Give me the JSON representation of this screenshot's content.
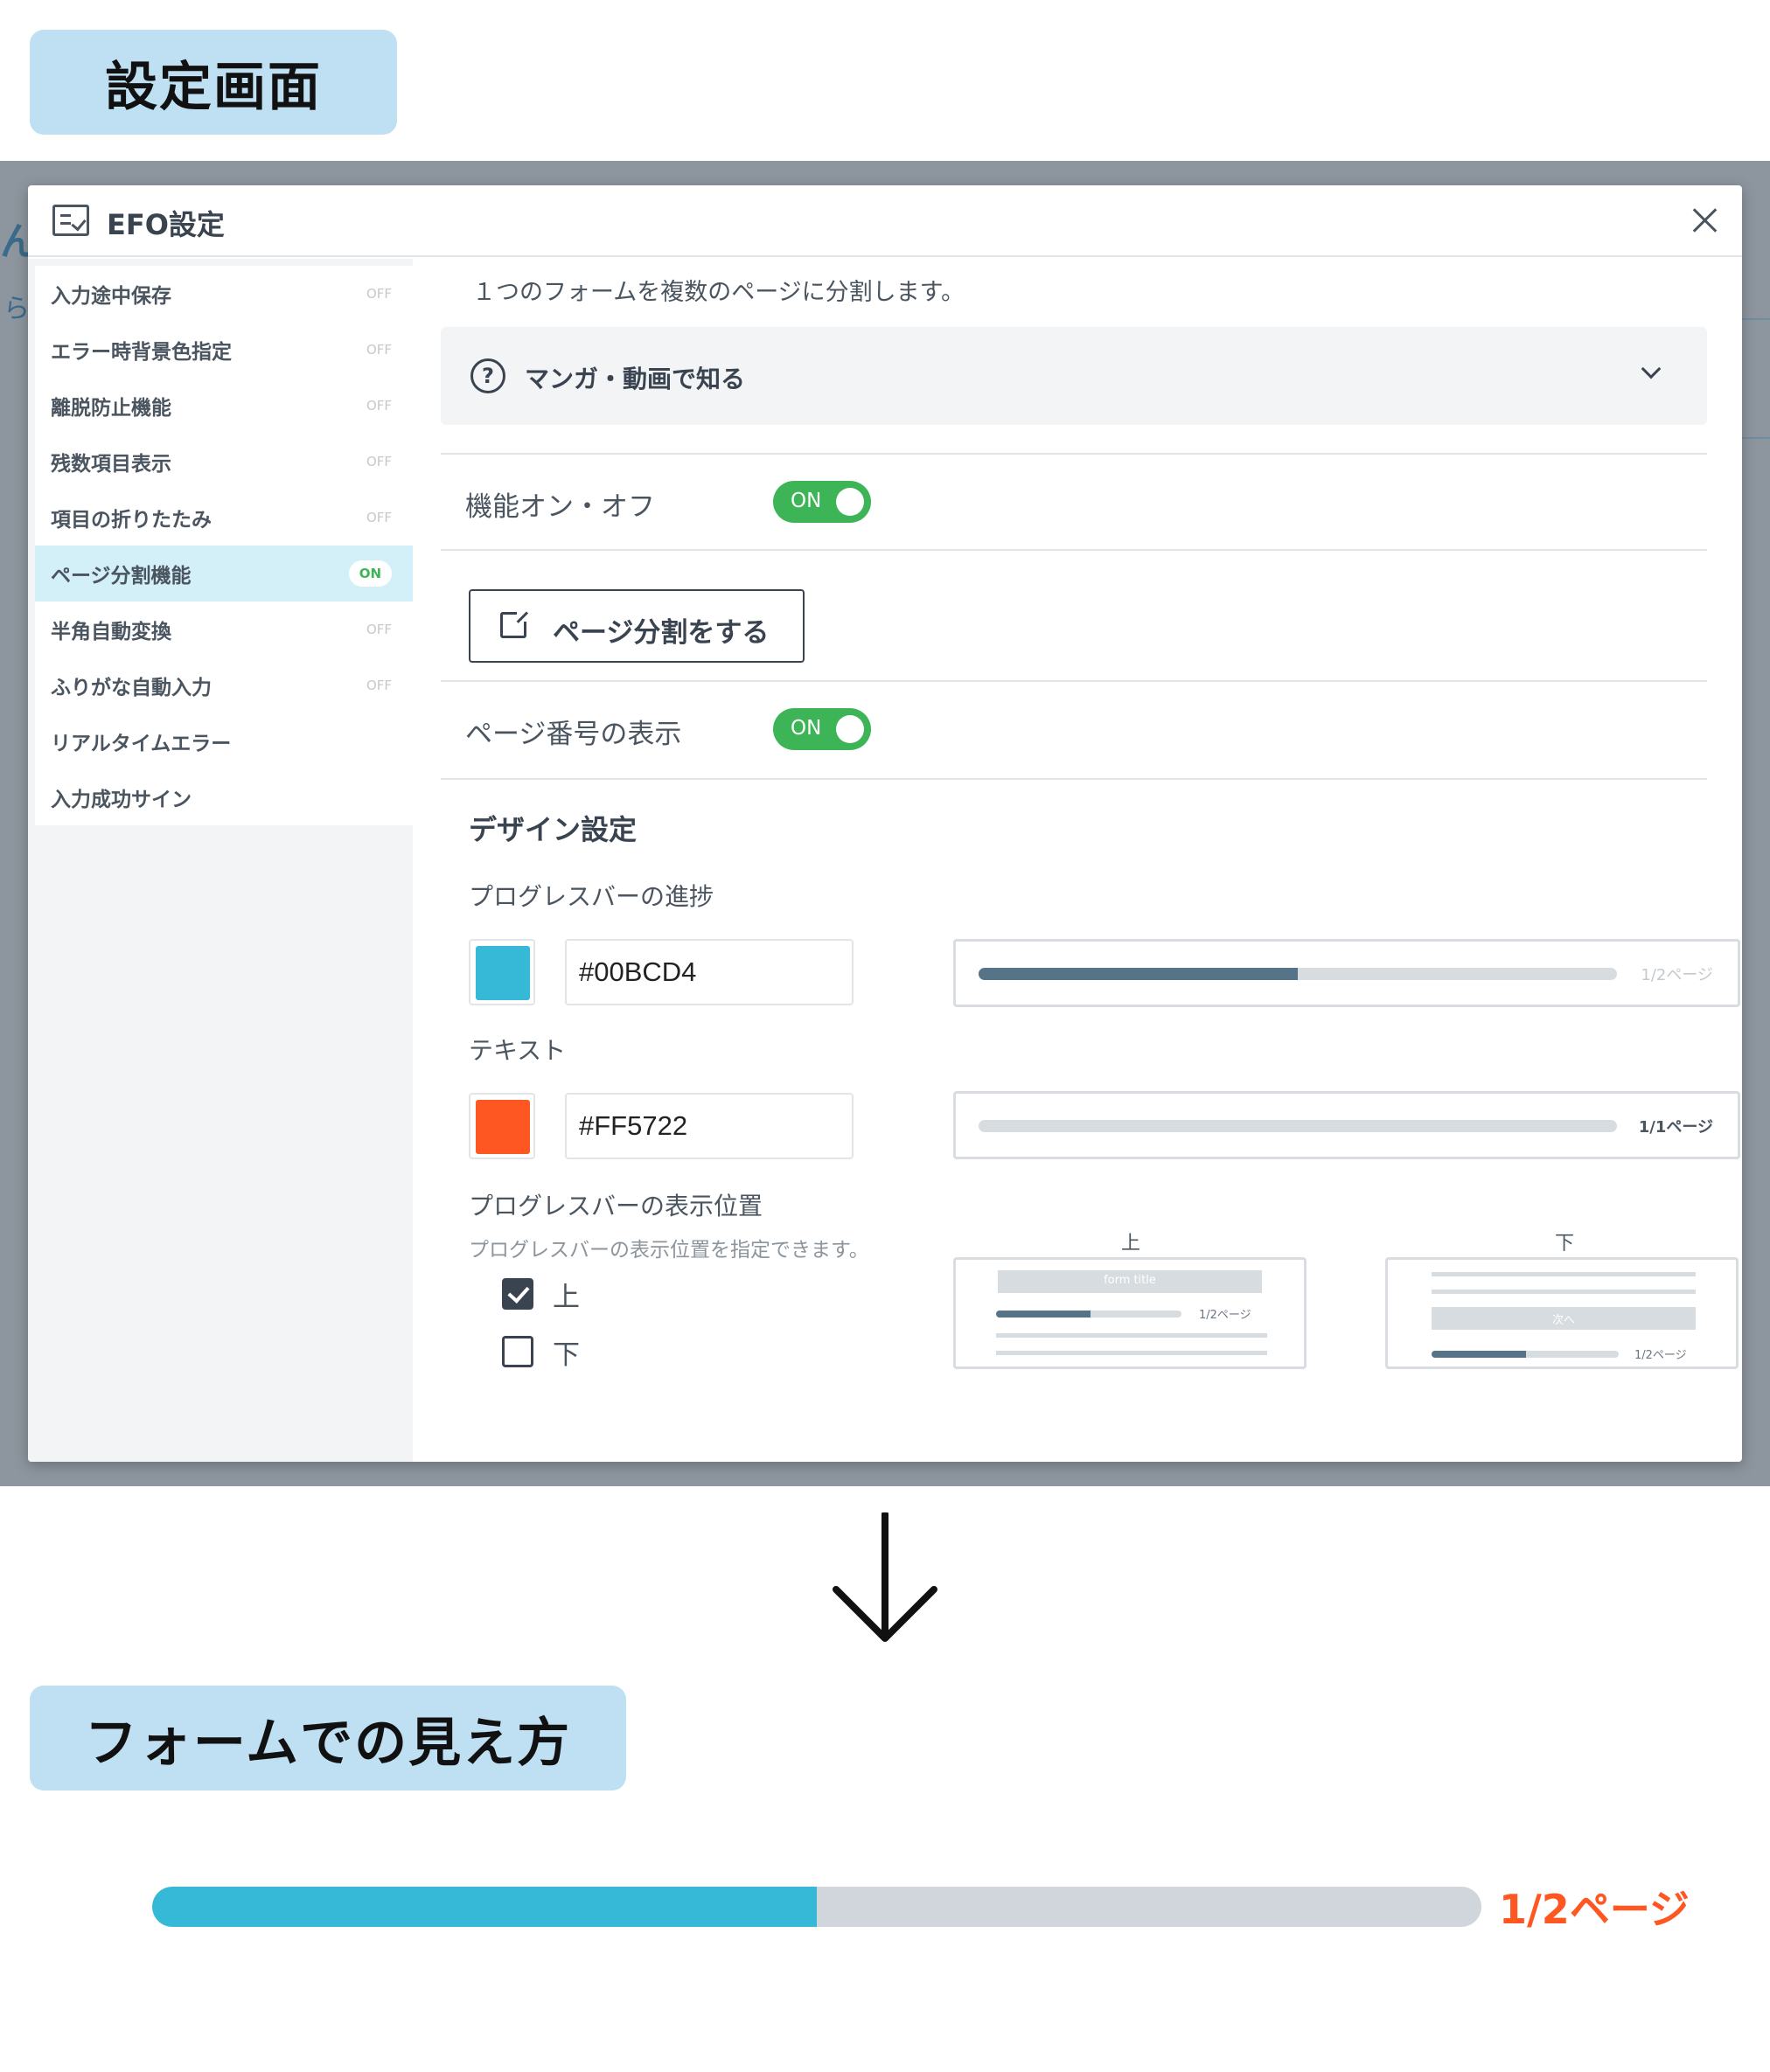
{
  "labels": {
    "settings_screen": "設定画面",
    "form_view": "フォームでの見え方"
  },
  "dialog": {
    "title": "EFO設定",
    "description": "１つのフォームを複数のページに分割します。",
    "manga_label": "マンガ・動画で知る",
    "feature_toggle_label": "機能オン・オフ",
    "feature_toggle_value": "ON",
    "page_split_button": "ページ分割をする",
    "page_number_label": "ページ番号の表示",
    "page_number_toggle_value": "ON",
    "design_title": "デザイン設定",
    "progress_label": "プログレスバーの進捗",
    "progress_color": "#00BCD4",
    "text_label": "テキスト",
    "text_color": "#FF5722",
    "preview1_text": "1/2ページ",
    "preview1_progress": 0.5,
    "preview2_text": "1/1ページ",
    "position_label": "プログレスバーの表示位置",
    "position_help": "プログレスバーの表示位置を指定できます。",
    "position_options": [
      {
        "label": "上",
        "checked": true
      },
      {
        "label": "下",
        "checked": false
      }
    ],
    "position_previews": {
      "top_caption": "上",
      "bottom_caption": "下",
      "form_title": "form title",
      "next_button": "次へ",
      "page_text": "1/2ページ"
    }
  },
  "sidebar": {
    "items": [
      {
        "label": "入力途中保存",
        "state": "OFF",
        "active": false
      },
      {
        "label": "エラー時背景色指定",
        "state": "OFF",
        "active": false
      },
      {
        "label": "離脱防止機能",
        "state": "OFF",
        "active": false
      },
      {
        "label": "残数項目表示",
        "state": "OFF",
        "active": false
      },
      {
        "label": "項目の折りたたみ",
        "state": "OFF",
        "active": false
      },
      {
        "label": "ページ分割機能",
        "state": "ON",
        "active": true
      },
      {
        "label": "半角自動変換",
        "state": "OFF",
        "active": false
      },
      {
        "label": "ふりがな自動入力",
        "state": "OFF",
        "active": false
      },
      {
        "label": "リアルタイムエラー",
        "state": "",
        "active": false
      },
      {
        "label": "入力成功サイン",
        "state": "",
        "active": false
      }
    ]
  },
  "form_preview": {
    "progress": 0.5,
    "page_text": "1/2ページ",
    "bar_color": "#35b9d6",
    "text_color": "#FF5722"
  },
  "background": {
    "peek_char_1": "ん",
    "peek_char_2": "ら"
  }
}
